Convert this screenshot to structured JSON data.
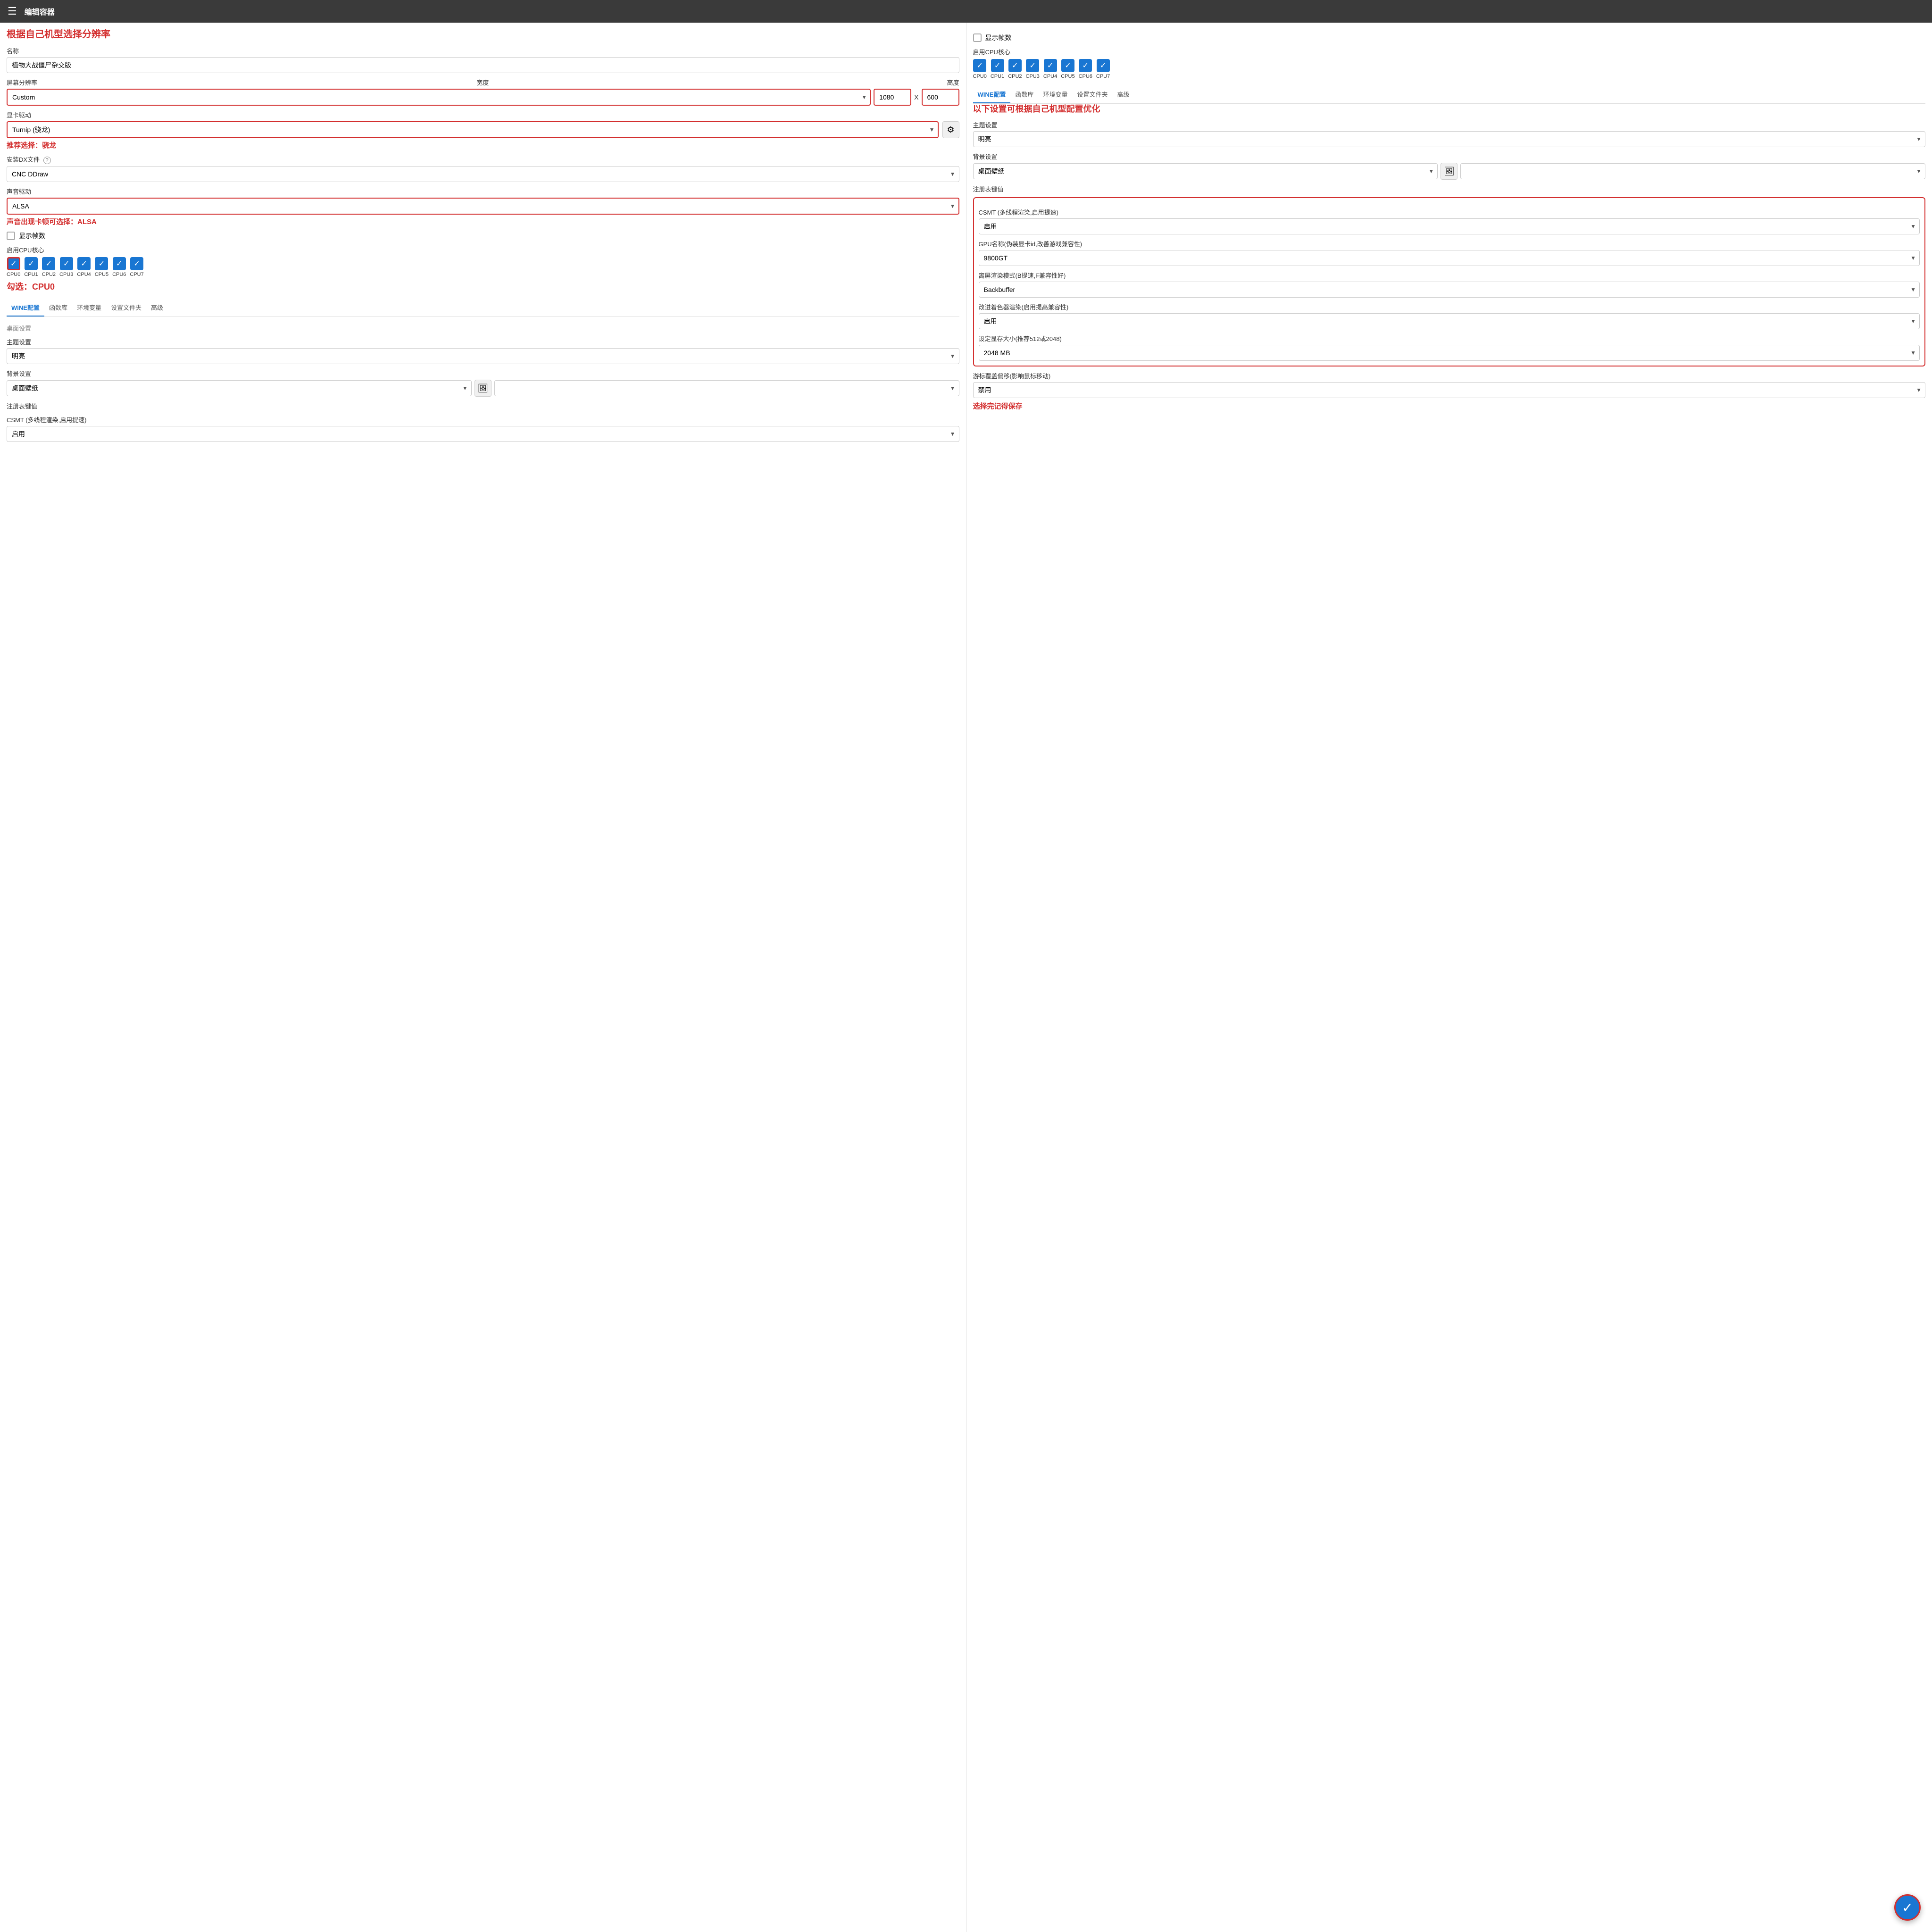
{
  "topbar": {
    "title": "编辑容器",
    "menu_icon": "☰"
  },
  "left": {
    "annotation_title": "根据自己机型选择分辨率",
    "name_label": "名称",
    "name_value": "植物大战僵尸杂交版",
    "resolution_label": "屏幕分辨率",
    "resolution_width_label": "宽度",
    "resolution_height_label": "高度",
    "resolution_preset": "Custom",
    "resolution_width": "1080",
    "resolution_height": "600",
    "gpu_driver_label": "显卡驱动",
    "gpu_driver_value": "Turnip (骁龙)",
    "gpu_driver_annotation": "推荐选择：骁龙",
    "dx_label": "安装DX文件",
    "dx_value": "CNC DDraw",
    "audio_label": "声音驱动",
    "audio_value": "ALSA",
    "audio_annotation": "声音出现卡顿可选择：ALSA",
    "show_fps_label": "显示帧数",
    "cpu_label": "启用CPU核心",
    "cpu_annotation": "勾选：CPU0",
    "cpus": [
      {
        "id": "CPU0",
        "checked": true,
        "highlighted": true
      },
      {
        "id": "CPU1",
        "checked": true,
        "highlighted": false
      },
      {
        "id": "CPU2",
        "checked": true,
        "highlighted": false
      },
      {
        "id": "CPU3",
        "checked": true,
        "highlighted": false
      },
      {
        "id": "CPU4",
        "checked": true,
        "highlighted": false
      },
      {
        "id": "CPU5",
        "checked": true,
        "highlighted": false
      },
      {
        "id": "CPU6",
        "checked": true,
        "highlighted": false
      },
      {
        "id": "CPU7",
        "checked": true,
        "highlighted": false
      }
    ],
    "tabs": [
      "WINE配置",
      "函数库",
      "环境变量",
      "设置文件夹",
      "高级"
    ],
    "active_tab": "WINE配置",
    "desktop_section_label": "桌面设置",
    "theme_label": "主题设置",
    "theme_value": "明亮",
    "bg_label": "背景设置",
    "bg_value": "桌面壁纸",
    "reg_label": "注册表键值",
    "csmt_label": "CSMT (多线程渲染,启用提速)",
    "csmt_value": "启用"
  },
  "right": {
    "show_fps_label": "显示帧数",
    "cpu_label": "启用CPU核心",
    "cpus": [
      {
        "id": "CPU0",
        "checked": true
      },
      {
        "id": "CPU1",
        "checked": true
      },
      {
        "id": "CPU2",
        "checked": true
      },
      {
        "id": "CPU3",
        "checked": true
      },
      {
        "id": "CPU4",
        "checked": true
      },
      {
        "id": "CPU5",
        "checked": true
      },
      {
        "id": "CPU6",
        "checked": true
      },
      {
        "id": "CPU7",
        "checked": true
      }
    ],
    "tabs": [
      "WINE配置",
      "函数库",
      "环境变量",
      "设置文件夹",
      "高级"
    ],
    "active_tab": "WINE配置",
    "annotation_title": "以下设置可根据自己机型配置优化",
    "theme_label": "主题设置",
    "theme_value": "明亮",
    "bg_label": "背景设置",
    "bg_value": "桌面壁纸",
    "reg_label": "注册表键值",
    "csmt_section_label": "CSMT (多线程渲染,启用提速)",
    "csmt_value": "启用",
    "gpu_name_section_label": "GPU名称(伪装显卡id,改善游戏兼容性)",
    "gpu_name_value": "9800GT",
    "offscreen_label": "离屏渲染模式(B提速,F兼容性好)",
    "offscreen_value": "Backbuffer",
    "shader_label": "改进着色器渲染(启用提高兼容性)",
    "shader_value": "启用",
    "vram_label": "设定显存大小(推荐512或2048)",
    "vram_value": "2048 MB",
    "cursor_label": "游标覆盖偏移(影响鼠标移动)",
    "cursor_value": "禁用",
    "cursor_annotation": "选择完记得保存",
    "save_label": "✓"
  }
}
